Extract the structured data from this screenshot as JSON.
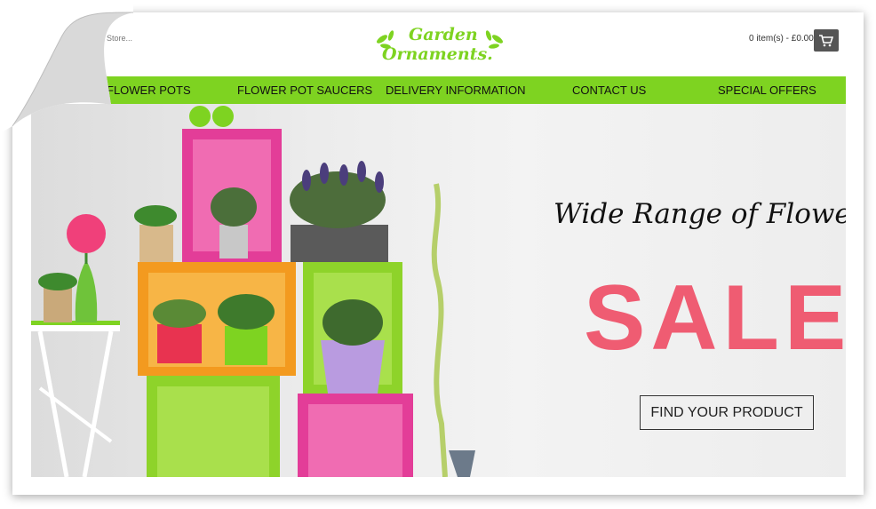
{
  "header": {
    "search_placeholder": "Store...",
    "logo_line1": "Garden",
    "logo_line2": "Ornaments.",
    "cart_summary": "0 item(s) - £0.00",
    "cart_icon": "shopping-cart-icon"
  },
  "nav": {
    "items": [
      {
        "label": "FLOWER POTS"
      },
      {
        "label": "FLOWER POT SAUCERS"
      },
      {
        "label": "DELIVERY INFORMATION"
      },
      {
        "label": "CONTACT US"
      },
      {
        "label": "SPECIAL OFFERS"
      }
    ]
  },
  "hero": {
    "headline": "Wide Range of Flower",
    "sale": "SALE",
    "cta_label": "FIND YOUR PRODUCT"
  },
  "colors": {
    "brand_green": "#7ed321",
    "sale_pink": "#ef5c72",
    "cart_button": "#555555"
  }
}
